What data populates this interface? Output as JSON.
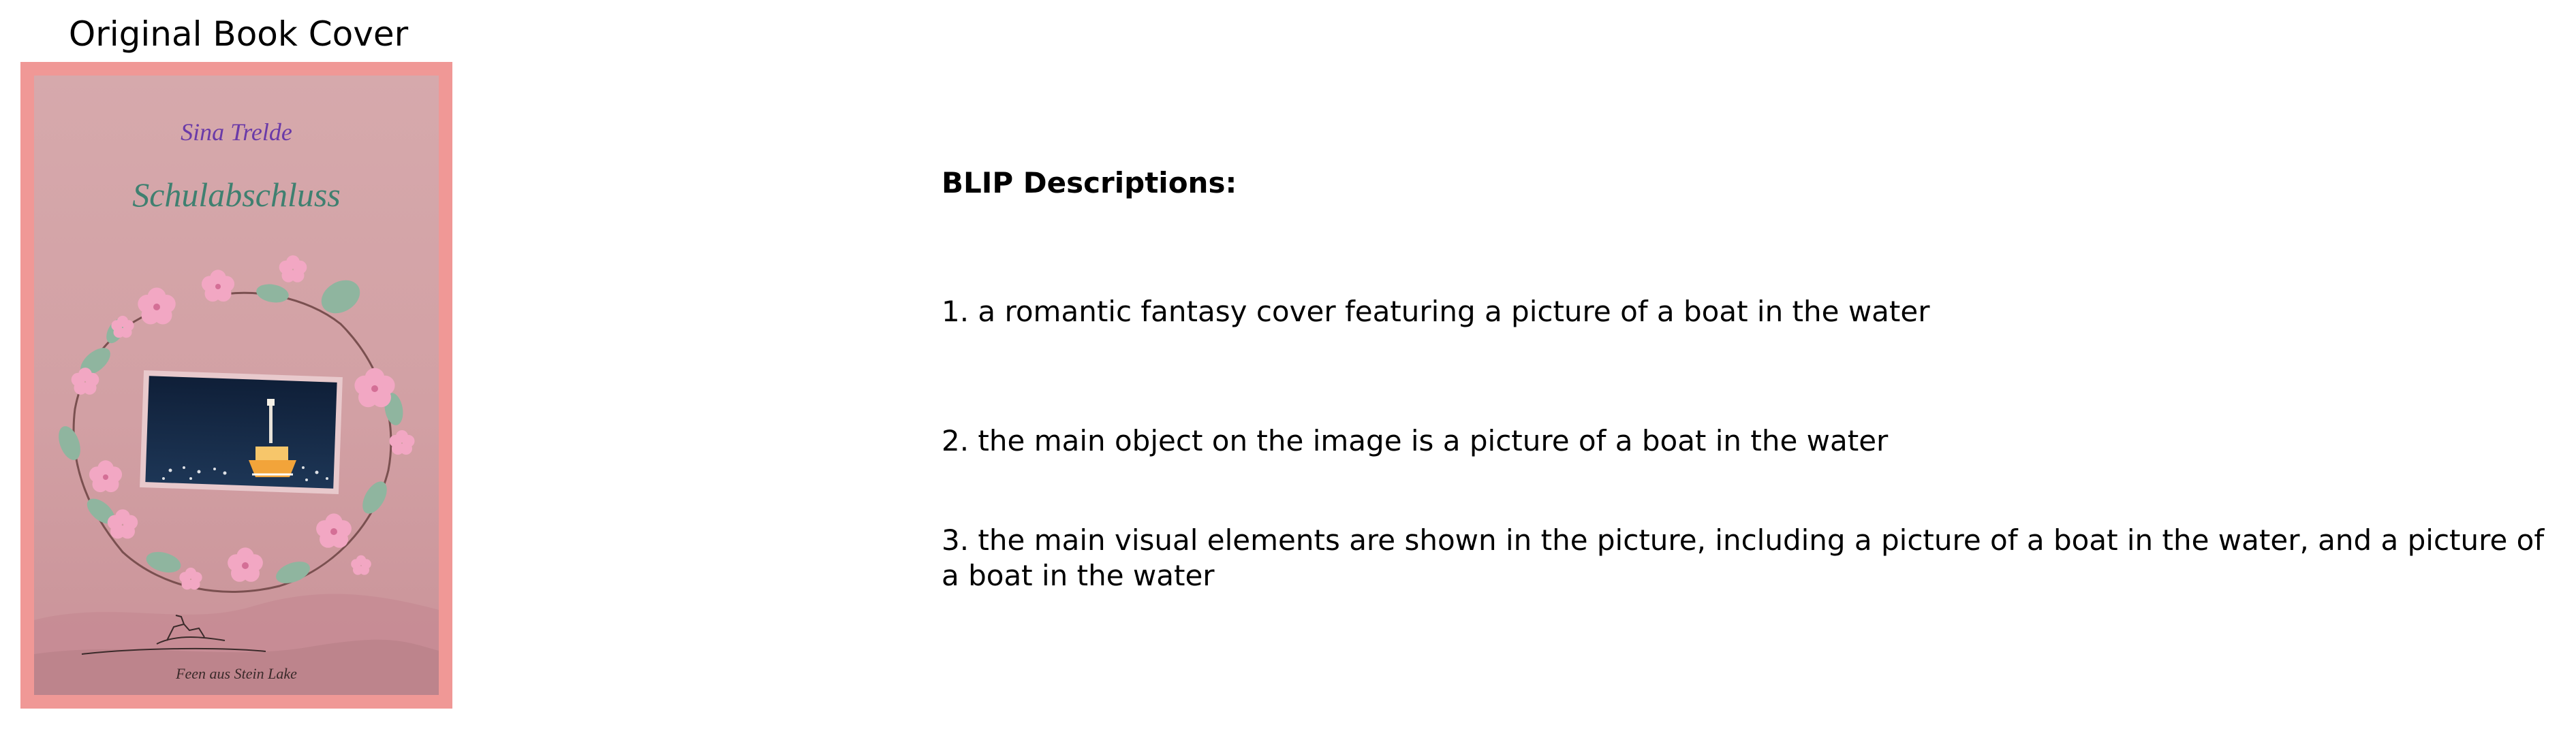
{
  "figure": {
    "cover_panel": {
      "title": "Original Book Cover",
      "cover": {
        "author": "Sina Trelde",
        "book_title": "Schulabschluss",
        "publisher_signature": "Feen aus Stein Lake",
        "colors": {
          "border": "#f09896",
          "background": "#d3a3a6",
          "night_sky": "#13253f",
          "author_text": "#6a3aa8",
          "title_text": "#3f8070",
          "blossom": "#f2a7c3",
          "leaf": "#8fb59f"
        }
      }
    },
    "descriptions_panel": {
      "heading": "BLIP Descriptions:",
      "items": [
        "1. a romantic fantasy cover featuring a picture of a boat in the water",
        "2. the main object on the image is a picture of a boat in the water",
        "3. the main visual elements are shown in the picture, including a picture of a boat in the water, and a picture of a boat in the water"
      ]
    }
  }
}
